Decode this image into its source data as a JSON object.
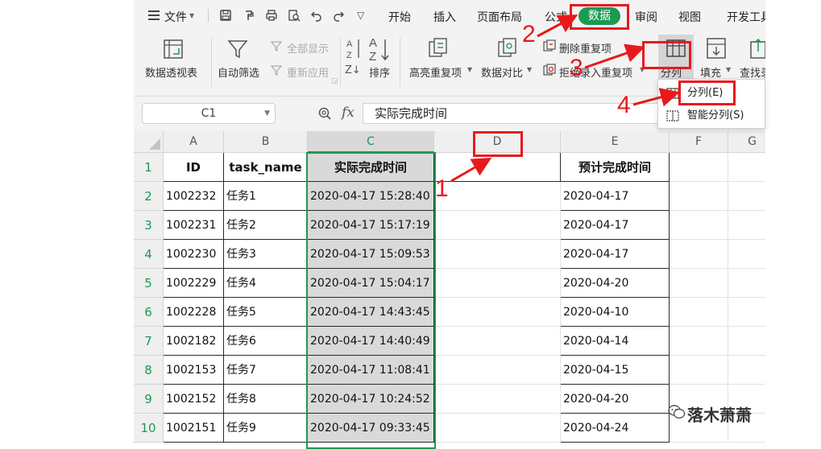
{
  "menu": {
    "file_label": "文件",
    "tabs": [
      "开始",
      "插入",
      "页面布局",
      "公式",
      "数据",
      "审阅",
      "视图",
      "开发工具"
    ],
    "active_tab": "数据"
  },
  "ribbon": {
    "pivot": "数据透视表",
    "autofilter": "自动筛选",
    "show_all": "全部显示",
    "reapply": "重新应用",
    "sort": "排序",
    "highlight_dup": "高亮重复项",
    "compare": "数据对比",
    "remove_dup": "删除重复项",
    "reject_dup": "拒绝录入重复项",
    "split": "分列",
    "fill": "填充",
    "find": "查找录入"
  },
  "split_menu": {
    "item1": "分列(E)",
    "item2": "智能分列(S)"
  },
  "formula_bar": {
    "name_box": "C1",
    "fx": "fx",
    "content": "实际完成时间"
  },
  "columns": [
    "A",
    "B",
    "C",
    "D",
    "E",
    "F",
    "G"
  ],
  "table": {
    "headers": [
      "ID",
      "task_name",
      "实际完成时间",
      "",
      "预计完成时间"
    ],
    "rows": [
      {
        "num": "1"
      },
      {
        "num": "2",
        "id": "1002232",
        "task": "任务1",
        "actual": "2020-04-17 15:28:40",
        "planned": "2020-04-17"
      },
      {
        "num": "3",
        "id": "1002231",
        "task": "任务2",
        "actual": "2020-04-17 15:17:19",
        "planned": "2020-04-17"
      },
      {
        "num": "4",
        "id": "1002230",
        "task": "任务3",
        "actual": "2020-04-17 15:09:53",
        "planned": "2020-04-17"
      },
      {
        "num": "5",
        "id": "1002229",
        "task": "任务4",
        "actual": "2020-04-17 15:04:17",
        "planned": "2020-04-20"
      },
      {
        "num": "6",
        "id": "1002228",
        "task": "任务5",
        "actual": "2020-04-17 14:43:45",
        "planned": "2020-04-10"
      },
      {
        "num": "7",
        "id": "1002182",
        "task": "任务6",
        "actual": "2020-04-17 14:40:49",
        "planned": "2020-04-14"
      },
      {
        "num": "8",
        "id": "1002153",
        "task": "任务7",
        "actual": "2020-04-17 11:08:41",
        "planned": "2020-04-15"
      },
      {
        "num": "9",
        "id": "1002152",
        "task": "任务8",
        "actual": "2020-04-17 10:24:52",
        "planned": "2020-04-20"
      },
      {
        "num": "10",
        "id": "1002151",
        "task": "任务9",
        "actual": "2020-04-17 09:33:45",
        "planned": "2020-04-24"
      }
    ]
  },
  "annotations": [
    "1",
    "2",
    "3",
    "4"
  ],
  "watermark": "落木萧萧",
  "colors": {
    "accent": "#1b9a52",
    "annotation": "#e8191d"
  }
}
